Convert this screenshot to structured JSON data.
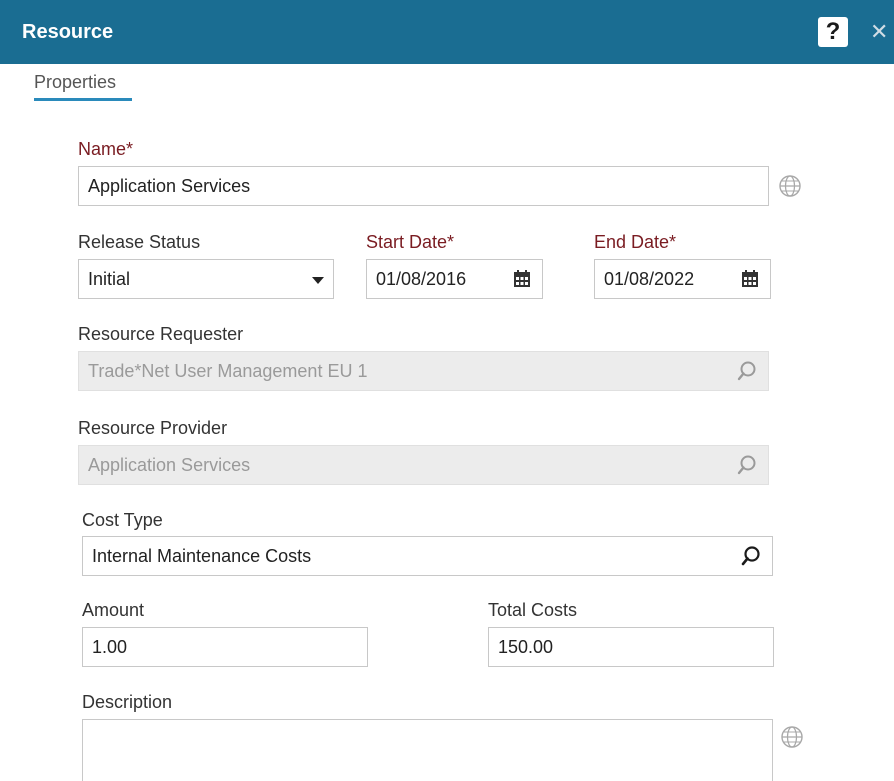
{
  "window": {
    "title": "Resource",
    "help_label": "?",
    "close_label": "✕"
  },
  "tabs": [
    {
      "label": "Properties",
      "active": true
    }
  ],
  "form": {
    "name": {
      "label": "Name*",
      "value": "Application Services"
    },
    "release_status": {
      "label": "Release Status",
      "value": "Initial"
    },
    "start_date": {
      "label": "Start Date*",
      "value": "01/08/2016"
    },
    "end_date": {
      "label": "End Date*",
      "value": "01/08/2022"
    },
    "resource_requester": {
      "label": "Resource Requester",
      "value": "Trade*Net User Management EU 1"
    },
    "resource_provider": {
      "label": "Resource Provider",
      "value": "Application Services"
    },
    "cost_type": {
      "label": "Cost Type",
      "value": "Internal Maintenance Costs"
    },
    "amount": {
      "label": "Amount",
      "value": "1.00"
    },
    "total_costs": {
      "label": "Total Costs",
      "value": "150.00"
    },
    "description": {
      "label": "Description",
      "value": ""
    }
  },
  "icons": {
    "help": "help-icon",
    "close": "close-icon",
    "calendar": "calendar-icon",
    "search": "search-icon",
    "globe": "globe-icon",
    "dropdown": "chevron-down-icon"
  },
  "colors": {
    "header": "#1a6d92",
    "required_label": "#7a1c22",
    "tab_underline": "#2a8abb",
    "disabled_field": "#ececec"
  }
}
